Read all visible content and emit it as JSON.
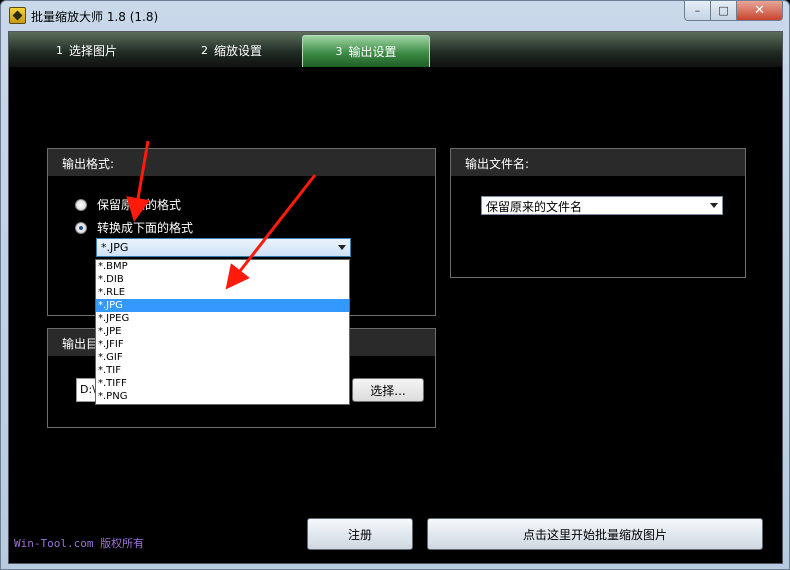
{
  "window": {
    "title": "批量缩放大师 1.8 (1.8)",
    "min_label": "–",
    "max_label": "□",
    "close_label": "✕"
  },
  "tabs": [
    {
      "num": "1",
      "label": "选择图片"
    },
    {
      "num": "2",
      "label": "缩放设置"
    },
    {
      "num": "3",
      "label": "输出设置"
    }
  ],
  "format_group": {
    "title": "输出格式:",
    "option_keep": "保留原来的格式",
    "option_convert": "转换成下面的格式",
    "selected_format": "*.JPG",
    "options": [
      "*.BMP",
      "*.DIB",
      "*.RLE",
      "*.JPG",
      "*.JPEG",
      "*.JPE",
      "*.JFIF",
      "*.GIF",
      "*.TIF",
      "*.TIFF",
      "*.PNG"
    ],
    "selected_index": 3
  },
  "dir_group": {
    "title": "输出目",
    "path_value": "D:\\",
    "choose_label": "选择..."
  },
  "filename_group": {
    "title": "输出文件名:",
    "selected": "保留原来的文件名"
  },
  "footer": {
    "copyright": "Win-Tool.com 版权所有",
    "register_label": "注册",
    "start_label": "点击这里开始批量缩放图片"
  },
  "colors": {
    "arrow": "#ff1a0a",
    "selected": "#3399ff",
    "footer_text": "#9b72d6"
  }
}
